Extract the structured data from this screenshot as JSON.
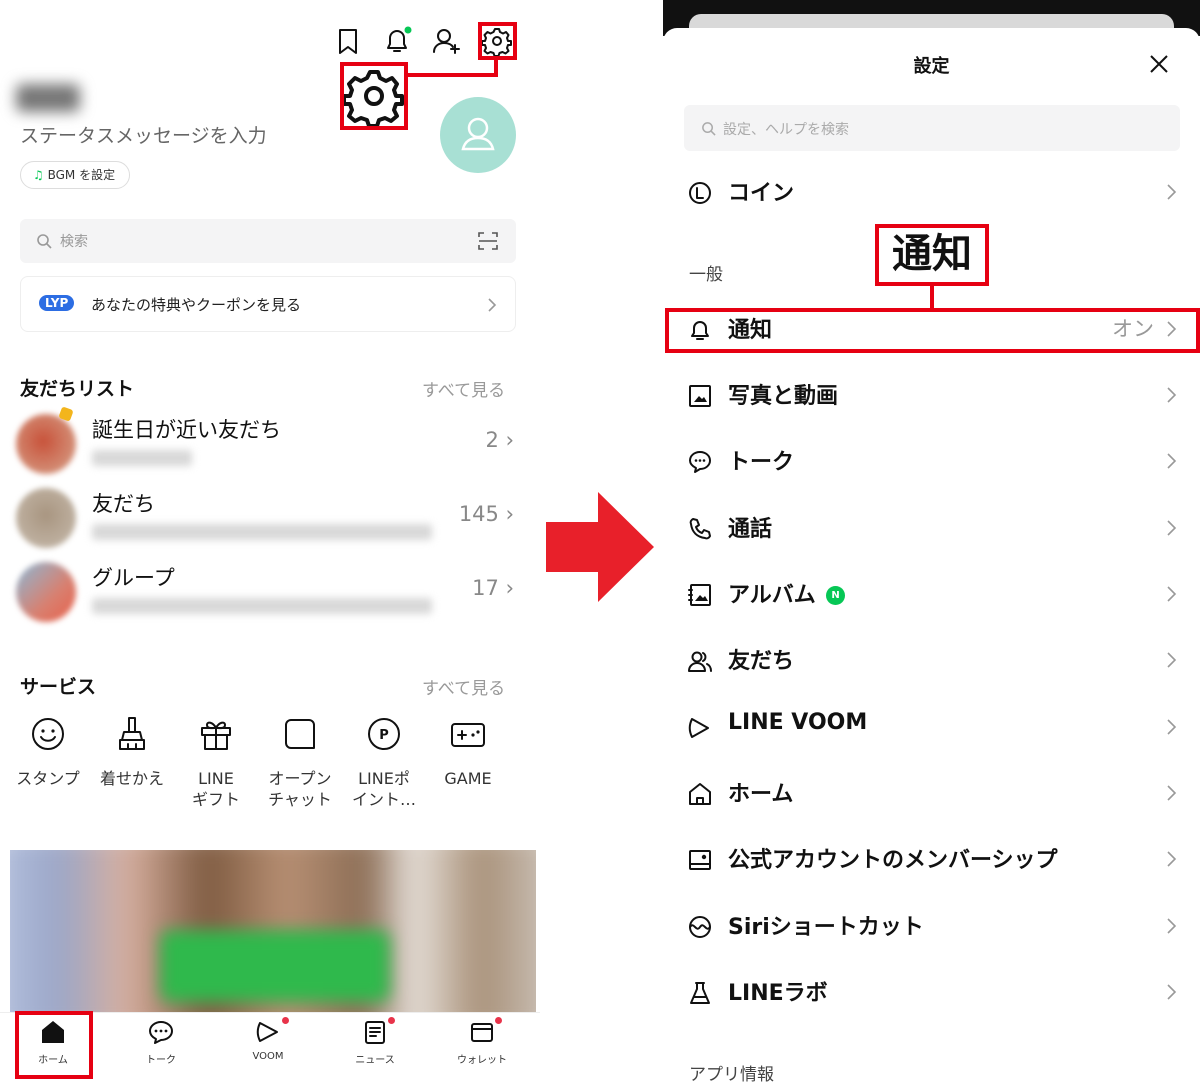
{
  "home": {
    "status_message": "ステータスメッセージを入力",
    "bgm_label": "BGM を設定",
    "search_placeholder": "検索",
    "lyp_badge": "LYP",
    "lyp_text": "あなたの特典やクーポンを見る",
    "friends_section": {
      "title": "友だちリスト",
      "see_all": "すべて見る",
      "rows": [
        {
          "name": "誕生日が近い友だち",
          "count": "2"
        },
        {
          "name": "友だち",
          "count": "145"
        },
        {
          "name": "グループ",
          "count": "17"
        }
      ]
    },
    "services_section": {
      "title": "サービス",
      "see_all": "すべて見る",
      "items": [
        {
          "label": "スタンプ",
          "icon": "smile-icon"
        },
        {
          "label": "着せかえ",
          "icon": "brush-icon"
        },
        {
          "label": "LINE\nギフト",
          "icon": "gift-icon"
        },
        {
          "label": "オープン\nチャット",
          "icon": "openchat-icon"
        },
        {
          "label": "LINEポ\nイント…",
          "icon": "points-icon"
        },
        {
          "label": "GAME",
          "icon": "game-icon"
        }
      ]
    },
    "tabs": [
      {
        "label": "ホーム",
        "icon": "home-icon"
      },
      {
        "label": "トーク",
        "icon": "chat-icon"
      },
      {
        "label": "VOOM",
        "icon": "voom-icon"
      },
      {
        "label": "ニュース",
        "icon": "news-icon"
      },
      {
        "label": "ウォレット",
        "icon": "wallet-icon"
      }
    ]
  },
  "settings": {
    "title": "設定",
    "search_placeholder": "設定、ヘルプを検索",
    "coin_label": "コイン",
    "general_header": "一般",
    "callout": "通知",
    "items": [
      {
        "label": "通知",
        "value": "オン",
        "icon": "bell-icon"
      },
      {
        "label": "写真と動画",
        "icon": "photo-icon"
      },
      {
        "label": "トーク",
        "icon": "chat-icon"
      },
      {
        "label": "通話",
        "icon": "phone-icon"
      },
      {
        "label": "アルバム",
        "icon": "album-icon",
        "badge": "N"
      },
      {
        "label": "友だち",
        "icon": "friends-icon"
      },
      {
        "label": "LINE VOOM",
        "icon": "voom-icon"
      },
      {
        "label": "ホーム",
        "icon": "home-icon"
      },
      {
        "label": "公式アカウントのメンバーシップ",
        "icon": "membership-icon"
      },
      {
        "label": "Siriショートカット",
        "icon": "siri-icon"
      },
      {
        "label": "LINEラボ",
        "icon": "flask-icon"
      }
    ],
    "app_info_header": "アプリ情報"
  },
  "colors": {
    "highlight": "#e60012",
    "line_green": "#06c755",
    "arrow": "#e8202a",
    "avatar_bg": "#a8e0d4"
  }
}
